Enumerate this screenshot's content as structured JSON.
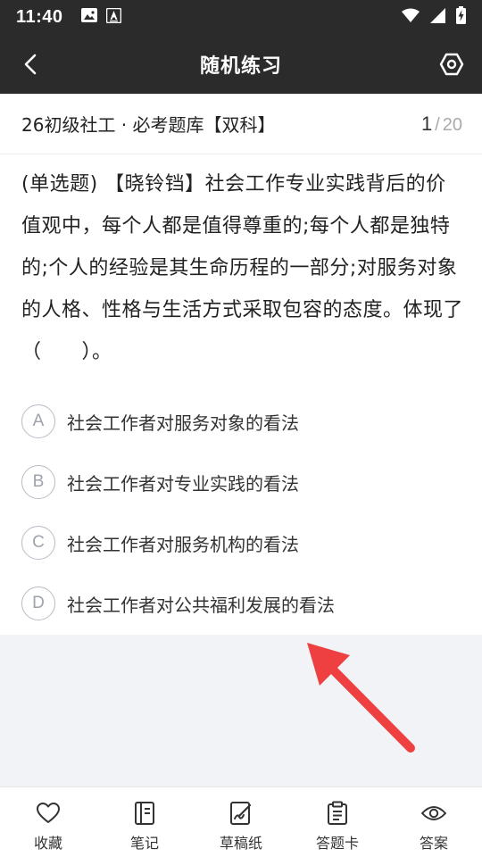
{
  "status_bar": {
    "time": "11:40",
    "left_icons": [
      "image-icon",
      "font-icon"
    ],
    "right_icons": [
      "wifi-icon",
      "signal-icon",
      "battery-charging-icon"
    ]
  },
  "nav": {
    "title": "随机练习",
    "back_icon": "chevron-left-icon",
    "settings_icon": "settings-icon"
  },
  "bank": {
    "name": "26初级社工 · 必考题库【双科】",
    "current": "1",
    "separator": "/",
    "total": "20"
  },
  "question": {
    "text": "(单选题) 【晓铃铛】社会工作专业实践背后的价值观中，每个人都是值得尊重的;每个人都是独特的;个人的经验是其生命历程的一部分;对服务对象的人格、性格与生活方式采取包容的态度。体现了（　　）。"
  },
  "options": [
    {
      "letter": "A",
      "text": "社会工作者对服务对象的看法"
    },
    {
      "letter": "B",
      "text": "社会工作者对专业实践的看法"
    },
    {
      "letter": "C",
      "text": "社会工作者对服务机构的看法"
    },
    {
      "letter": "D",
      "text": "社会工作者对公共福利发展的看法"
    }
  ],
  "bottom_tabs": [
    {
      "label": "收藏",
      "icon": "heart-icon"
    },
    {
      "label": "笔记",
      "icon": "notebook-icon"
    },
    {
      "label": "草稿纸",
      "icon": "draft-paper-icon"
    },
    {
      "label": "答题卡",
      "icon": "answer-card-icon"
    },
    {
      "label": "答案",
      "icon": "eye-icon"
    }
  ],
  "colors": {
    "header_bg": "#2b2b2b",
    "content_bg": "#f1f3f6",
    "arrow": "#ee4040",
    "option_border": "#b9bcc6"
  }
}
